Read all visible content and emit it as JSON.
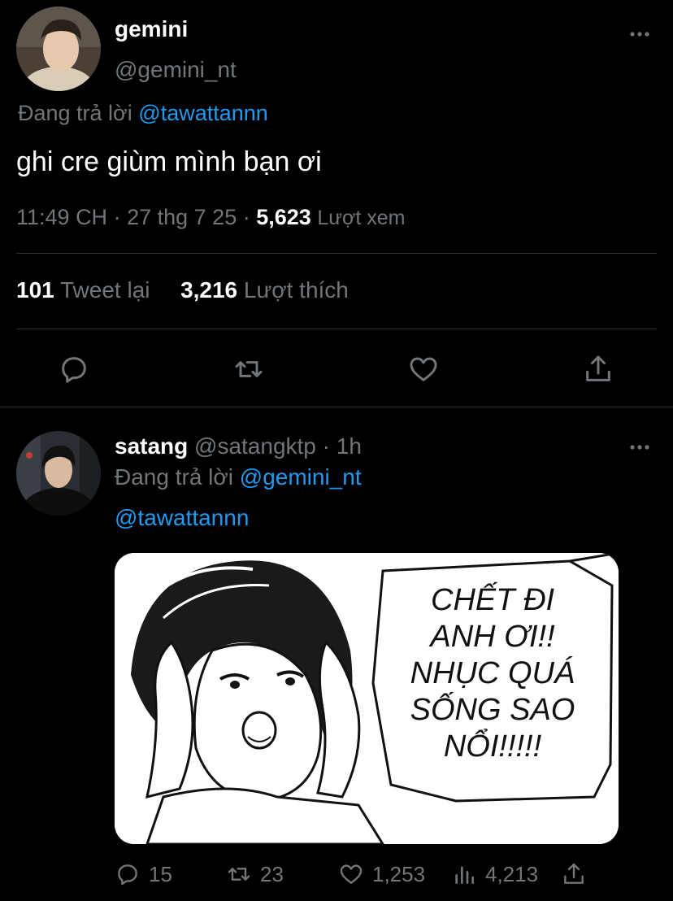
{
  "main_tweet": {
    "display_name": "gemini",
    "handle": "@gemini_nt",
    "replying_prefix": "Đang trả lời",
    "replying_to": "@tawattannn",
    "text": "ghi cre giùm mình bạn ơi",
    "time": "11:49 CH",
    "date": "27 thg 7 25",
    "views": "5,623",
    "views_label": "Lượt xem",
    "retweets": "101",
    "retweets_label": "Tweet lại",
    "likes": "3,216",
    "likes_label": "Lượt thích",
    "actions": [
      "reply-icon",
      "retweet-icon",
      "like-icon",
      "share-icon"
    ]
  },
  "reply_tweet": {
    "display_name": "satang",
    "handle": "@satangktp",
    "time_ago": "1h",
    "replying_prefix": "Đang trả lời",
    "replying_to": "@gemini_nt",
    "mention": "@tawattannn",
    "media_text": [
      "CHẾT ĐI",
      "ANH ƠI!!",
      "NHỤC QUÁ",
      "SỐNG SAO",
      "NỔI!!!!!"
    ],
    "replies": "15",
    "retweets": "23",
    "likes": "1,253",
    "views": "4,213"
  },
  "separator": "·",
  "colors": {
    "background": "#000000",
    "text": "#e7e9ea",
    "muted": "#71767b",
    "accent": "#1d9bf0",
    "divider": "#2f3336"
  }
}
